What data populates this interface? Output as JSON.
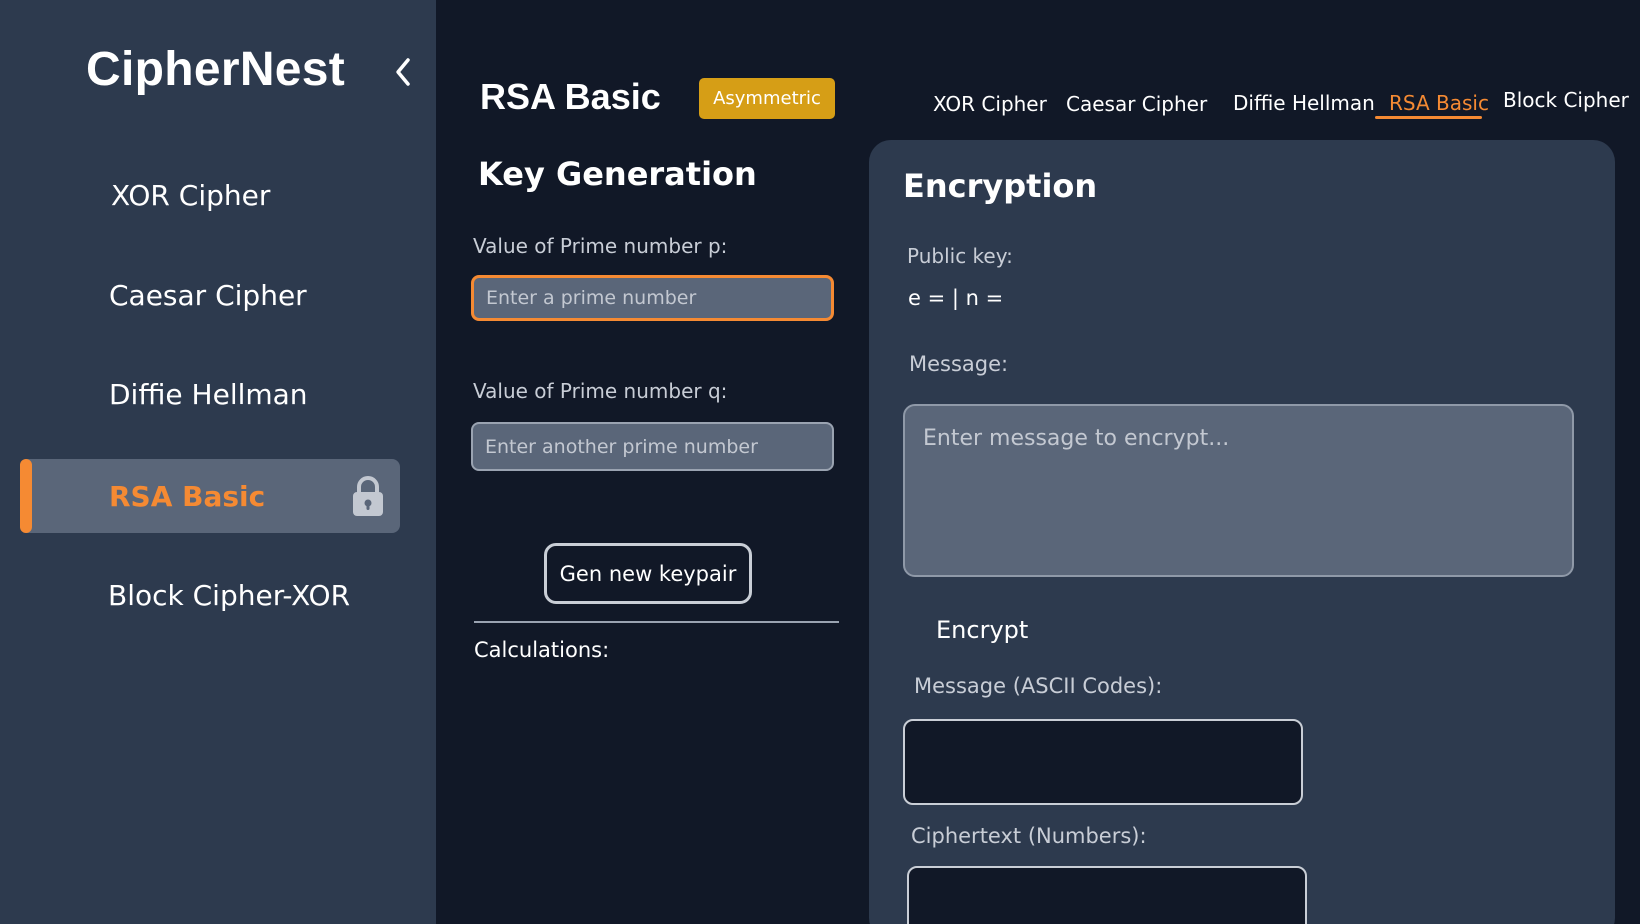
{
  "app": {
    "brand": "CipherNest"
  },
  "sidebar": {
    "collapse_icon": "chevron-left-icon",
    "items": [
      {
        "label": "XOR Cipher",
        "active": false
      },
      {
        "label": "Caesar Cipher",
        "active": false
      },
      {
        "label": "Diffie Hellman",
        "active": false
      },
      {
        "label": "RSA Basic",
        "active": true,
        "icon": "lock-icon"
      },
      {
        "label": "Block Cipher-XOR",
        "active": false
      }
    ]
  },
  "header": {
    "title": "RSA Basic",
    "badge": "Asymmetric",
    "tabs": [
      {
        "label": "XOR Cipher"
      },
      {
        "label": "Caesar Cipher"
      },
      {
        "label": "Diffie Hellman"
      },
      {
        "label": "RSA Basic",
        "active": true
      },
      {
        "label": "Block Cipher"
      }
    ]
  },
  "keygen": {
    "title": "Key Generation",
    "p_label": "Value of Prime number p:",
    "p_placeholder": "Enter a prime number",
    "q_label": "Value of Prime number q:",
    "q_placeholder": "Enter another prime number",
    "button": "Gen new keypair",
    "calculations_label": "Calculations:"
  },
  "encryption": {
    "title": "Encryption",
    "public_key_label": "Public key:",
    "public_key_value": "e = | n =",
    "message_label": "Message:",
    "message_placeholder": "Enter message to encrypt...",
    "encrypt_button": "Encrypt",
    "ascii_label": "Message (ASCII Codes):",
    "ciphertext_label": "Ciphertext (Numbers):"
  },
  "colors": {
    "accent": "#f58a33",
    "badge": "#d69e16",
    "sidebar_bg": "#2d3a4e",
    "main_bg": "#111827"
  }
}
